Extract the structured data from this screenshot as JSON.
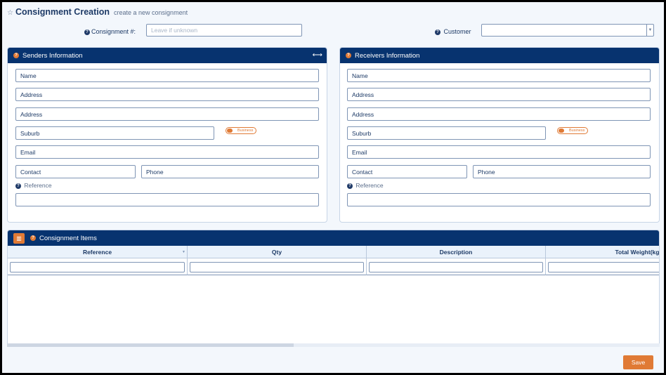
{
  "page": {
    "title": "Consignment Creation",
    "subtitle": "create a new consignment"
  },
  "header": {
    "consignment_label": "Consignment #:",
    "consignment_placeholder": "Leave if unknown",
    "customer_label": "Customer",
    "customer_value": ""
  },
  "senders": {
    "title": "Senders Information",
    "name": "Name",
    "address1": "Address",
    "address2": "Address",
    "suburb": "Suburb",
    "business_toggle": "Business",
    "email": "Email",
    "contact": "Contact",
    "phone": "Phone",
    "reference_label": "Reference"
  },
  "receivers": {
    "title": "Receivers Information",
    "name": "Name",
    "address1": "Address",
    "address2": "Address",
    "suburb": "Suburb",
    "business_toggle": "Business",
    "email": "Email",
    "contact": "Contact",
    "phone": "Phone",
    "reference_label": "Reference"
  },
  "items": {
    "title": "Consignment Items",
    "columns": [
      "Reference",
      "Qty",
      "Description",
      "Total Weight(kgs)"
    ]
  },
  "actions": {
    "save": "Save"
  },
  "colors": {
    "navy": "#07336f",
    "accent": "#e07a35"
  },
  "icons": [
    "star-icon",
    "help-icon",
    "expand-icon",
    "book-icon",
    "sort-icon",
    "dropdown-arrow-icon"
  ]
}
